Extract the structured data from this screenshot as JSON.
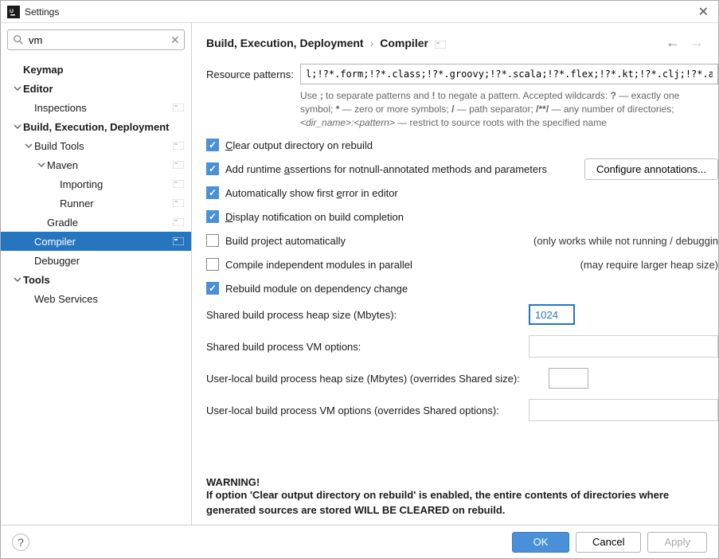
{
  "titlebar": {
    "title": "Settings"
  },
  "search": {
    "value": "vm"
  },
  "tree": {
    "keymap": "Keymap",
    "editor": "Editor",
    "inspections": "Inspections",
    "bed": "Build, Execution, Deployment",
    "buildtools": "Build Tools",
    "maven": "Maven",
    "importing": "Importing",
    "runner": "Runner",
    "gradle": "Gradle",
    "compiler": "Compiler",
    "debugger": "Debugger",
    "tools": "Tools",
    "webservices": "Web Services"
  },
  "breadcrumb": {
    "part1": "Build, Execution, Deployment",
    "sep": "›",
    "part2": "Compiler"
  },
  "labels": {
    "resource_patterns": "Resource patterns:",
    "pattern_hint_prefix": "Use ",
    "pattern_hint_semicolon": ";",
    "pattern_hint_1": " to separate patterns and ",
    "pattern_hint_bang": "!",
    "pattern_hint_2": " to negate a pattern. Accepted wildcards: ",
    "pattern_hint_q": "?",
    "pattern_hint_3": " — exactly one symbol; ",
    "pattern_hint_star": "*",
    "pattern_hint_4": " — zero or more symbols; ",
    "pattern_hint_slash": "/",
    "pattern_hint_5": " — path separator; ",
    "pattern_hint_dblstar": "/**/",
    "pattern_hint_6": " — any number of directories; ",
    "pattern_hint_dir": "<dir_name>:<pattern>",
    "pattern_hint_7": " — restrict to source roots with the specified name",
    "shared_heap": "Shared build process heap size (Mbytes):",
    "shared_vm": "Shared build process VM options:",
    "user_heap": "User-local build process heap size (Mbytes) (overrides Shared size):",
    "user_vm": "User-local build process VM options (overrides Shared options):"
  },
  "values": {
    "resource_patterns": "l;!?*.form;!?*.class;!?*.groovy;!?*.scala;!?*.flex;!?*.kt;!?*.clj;!?*.aj",
    "shared_heap": "1024",
    "shared_vm": "",
    "user_heap": "",
    "user_vm": ""
  },
  "checkboxes": {
    "clear_output": "lear output directory on rebuild",
    "runtime_assert": "Add runtime ",
    "runtime_assert_u": "a",
    "runtime_assert_2": "ssertions for notnull-annotated methods and parameters",
    "auto_show_error": "Automatically show first ",
    "auto_show_error_u": "e",
    "auto_show_error_2": "rror in editor",
    "display_notif": "isplay notification on build completion",
    "build_auto": "Build project automatically",
    "build_auto_note": "(only works while not running / debuggin",
    "compile_parallel": "Compile independent modules in parallel",
    "compile_parallel_note": "(may require larger heap size)",
    "rebuild_dep": "Rebuild module on dependency change"
  },
  "buttons": {
    "configure": "Configure annotations...",
    "ok": "OK",
    "cancel": "Cancel",
    "apply": "Apply"
  },
  "warning": {
    "title": "WARNING!",
    "text": "If option 'Clear output directory on rebuild' is enabled, the entire contents of directories where generated sources are stored WILL BE CLEARED on rebuild."
  }
}
